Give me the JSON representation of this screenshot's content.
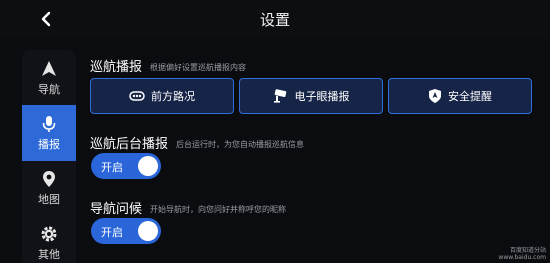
{
  "header": {
    "title": "设置"
  },
  "sidebar": {
    "items": [
      {
        "label": "导航",
        "icon": "navigation-arrow-icon",
        "active": false
      },
      {
        "label": "播报",
        "icon": "microphone-icon",
        "active": true
      },
      {
        "label": "地图",
        "icon": "map-pin-icon",
        "active": false
      },
      {
        "label": "其他",
        "icon": "gear-icon",
        "active": false
      }
    ]
  },
  "cruise_broadcast": {
    "title": "巡航播报",
    "hint": "根据偏好设置巡航播报内容",
    "options": [
      {
        "label": "前方路况",
        "icon": "traffic-icon"
      },
      {
        "label": "电子眼播报",
        "icon": "camera-icon"
      },
      {
        "label": "安全提醒",
        "icon": "shield-icon"
      }
    ]
  },
  "background_broadcast": {
    "title": "巡航后台播报",
    "hint": "后台运行时，为您自动播报巡航信息",
    "toggle_label": "开启",
    "enabled": true
  },
  "nav_greeting": {
    "title": "导航问候",
    "hint": "开始导航时，向您问好并称呼您的昵称",
    "toggle_label": "开启",
    "enabled": true
  },
  "watermark": {
    "line1": "百度知道分站",
    "line2": "www.baidu.com"
  },
  "colors": {
    "accent": "#2a66d9",
    "background": "#0b0c10",
    "button_fill": "#162447"
  }
}
